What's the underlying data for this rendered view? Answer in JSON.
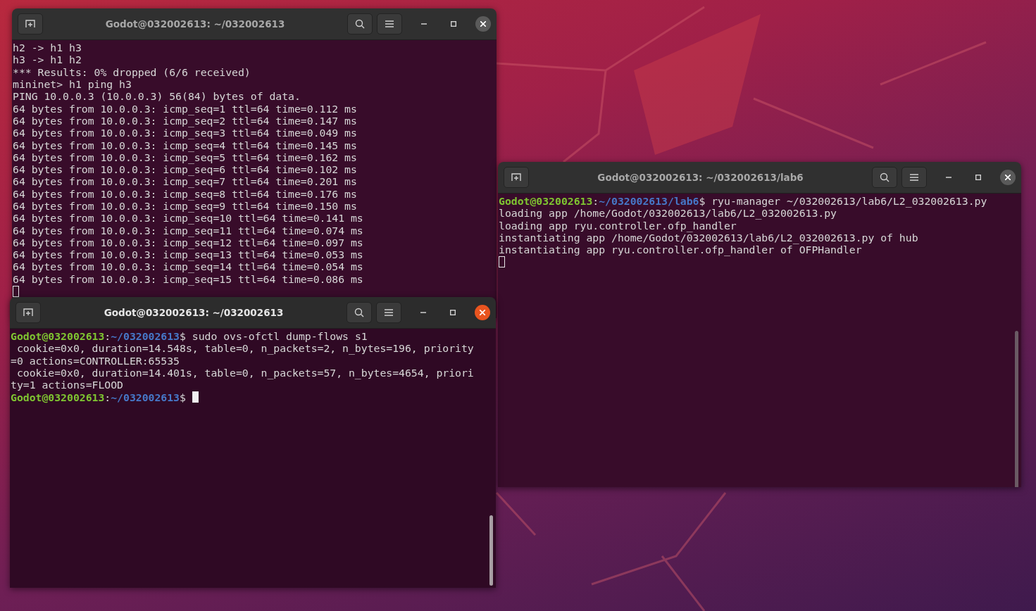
{
  "windows": [
    {
      "title": "Godot@032002613: ~/032002613",
      "focused": false,
      "lines": [
        {
          "kind": "output",
          "text": "h2 -> h1 h3"
        },
        {
          "kind": "output",
          "text": "h3 -> h1 h2"
        },
        {
          "kind": "output",
          "text": "*** Results: 0% dropped (6/6 received)"
        },
        {
          "kind": "output",
          "text": "mininet> h1 ping h3"
        },
        {
          "kind": "output",
          "text": "PING 10.0.0.3 (10.0.0.3) 56(84) bytes of data."
        },
        {
          "kind": "output",
          "text": "64 bytes from 10.0.0.3: icmp_seq=1 ttl=64 time=0.112 ms"
        },
        {
          "kind": "output",
          "text": "64 bytes from 10.0.0.3: icmp_seq=2 ttl=64 time=0.147 ms"
        },
        {
          "kind": "output",
          "text": "64 bytes from 10.0.0.3: icmp_seq=3 ttl=64 time=0.049 ms"
        },
        {
          "kind": "output",
          "text": "64 bytes from 10.0.0.3: icmp_seq=4 ttl=64 time=0.145 ms"
        },
        {
          "kind": "output",
          "text": "64 bytes from 10.0.0.3: icmp_seq=5 ttl=64 time=0.162 ms"
        },
        {
          "kind": "output",
          "text": "64 bytes from 10.0.0.3: icmp_seq=6 ttl=64 time=0.102 ms"
        },
        {
          "kind": "output",
          "text": "64 bytes from 10.0.0.3: icmp_seq=7 ttl=64 time=0.201 ms"
        },
        {
          "kind": "output",
          "text": "64 bytes from 10.0.0.3: icmp_seq=8 ttl=64 time=0.176 ms"
        },
        {
          "kind": "output",
          "text": "64 bytes from 10.0.0.3: icmp_seq=9 ttl=64 time=0.150 ms"
        },
        {
          "kind": "output",
          "text": "64 bytes from 10.0.0.3: icmp_seq=10 ttl=64 time=0.141 ms"
        },
        {
          "kind": "output",
          "text": "64 bytes from 10.0.0.3: icmp_seq=11 ttl=64 time=0.074 ms"
        },
        {
          "kind": "output",
          "text": "64 bytes from 10.0.0.3: icmp_seq=12 ttl=64 time=0.097 ms"
        },
        {
          "kind": "output",
          "text": "64 bytes from 10.0.0.3: icmp_seq=13 ttl=64 time=0.053 ms"
        },
        {
          "kind": "output",
          "text": "64 bytes from 10.0.0.3: icmp_seq=14 ttl=64 time=0.054 ms"
        },
        {
          "kind": "output",
          "text": "64 bytes from 10.0.0.3: icmp_seq=15 ttl=64 time=0.086 ms"
        },
        {
          "kind": "cursor"
        }
      ]
    },
    {
      "title": "Godot@032002613: ~/032002613/lab6",
      "focused": false,
      "lines": [
        {
          "kind": "prompt",
          "user": "Godot@032002613",
          "separator": ":",
          "path": "~/032002613/lab6",
          "rest": "$ ryu-manager ~/032002613/lab6/L2_032002613.py"
        },
        {
          "kind": "output",
          "text": "loading app /home/Godot/032002613/lab6/L2_032002613.py"
        },
        {
          "kind": "output",
          "text": "loading app ryu.controller.ofp_handler"
        },
        {
          "kind": "output",
          "text": "instantiating app /home/Godot/032002613/lab6/L2_032002613.py of hub"
        },
        {
          "kind": "output",
          "text": "instantiating app ryu.controller.ofp_handler of OFPHandler"
        },
        {
          "kind": "cursor"
        }
      ]
    },
    {
      "title": "Godot@032002613: ~/032002613",
      "focused": true,
      "lines": [
        {
          "kind": "prompt",
          "user": "Godot@032002613",
          "separator": ":",
          "path": "~/032002613",
          "rest": "$ sudo ovs-ofctl dump-flows s1"
        },
        {
          "kind": "output",
          "text": " cookie=0x0, duration=14.548s, table=0, n_packets=2, n_bytes=196, priority"
        },
        {
          "kind": "output",
          "text": "=0 actions=CONTROLLER:65535"
        },
        {
          "kind": "output",
          "text": " cookie=0x0, duration=14.401s, table=0, n_packets=57, n_bytes=4654, priori"
        },
        {
          "kind": "output",
          "text": "ty=1 actions=FLOOD"
        },
        {
          "kind": "prompt",
          "user": "Godot@032002613",
          "separator": ":",
          "path": "~/032002613",
          "rest": "$",
          "cursor": true
        }
      ]
    }
  ]
}
